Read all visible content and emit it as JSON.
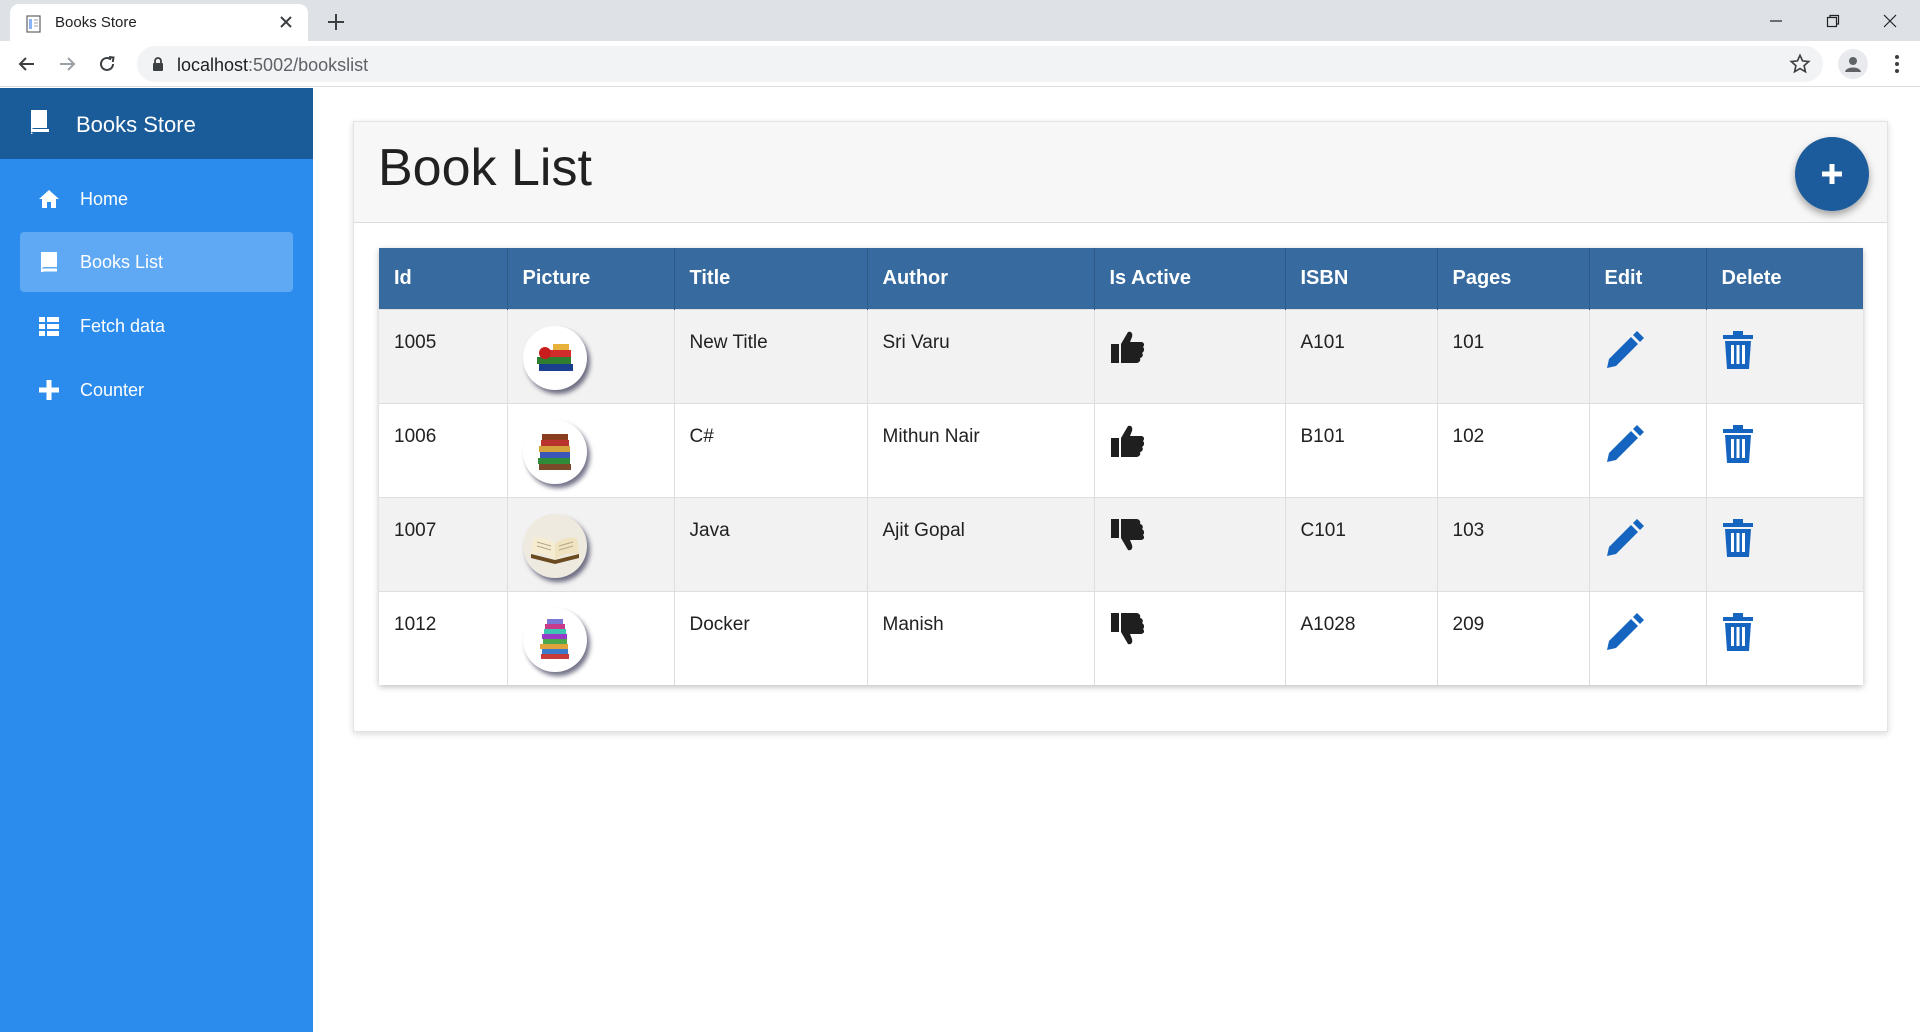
{
  "browser": {
    "tab_title": "Books Store",
    "url_host": "localhost",
    "url_path": ":5002/bookslist"
  },
  "app": {
    "brand": "Books Store"
  },
  "sidebar": {
    "items": [
      {
        "label": "Home",
        "icon": "home-icon",
        "active": false
      },
      {
        "label": "Books List",
        "icon": "book-icon",
        "active": true
      },
      {
        "label": "Fetch data",
        "icon": "list-icon",
        "active": false
      },
      {
        "label": "Counter",
        "icon": "plus-icon",
        "active": false
      }
    ]
  },
  "page": {
    "title": "Book List",
    "add_icon": "plus-icon"
  },
  "table": {
    "headers": [
      "Id",
      "Picture",
      "Title",
      "Author",
      "Is Active",
      "ISBN",
      "Pages",
      "Edit",
      "Delete"
    ],
    "rows": [
      {
        "id": "1005",
        "picture": "book-stack-red",
        "title": "New Title",
        "author": "Sri Varu",
        "is_active": true,
        "isbn": "A101",
        "pages": "101"
      },
      {
        "id": "1006",
        "picture": "book-stack-colored",
        "title": "C#",
        "author": "Mithun Nair",
        "is_active": true,
        "isbn": "B101",
        "pages": "102"
      },
      {
        "id": "1007",
        "picture": "open-book",
        "title": "Java",
        "author": "Ajit Gopal",
        "is_active": false,
        "isbn": "C101",
        "pages": "103"
      },
      {
        "id": "1012",
        "picture": "book-stack-tall",
        "title": "Docker",
        "author": "Manish",
        "is_active": false,
        "isbn": "A1028",
        "pages": "209"
      }
    ]
  },
  "colors": {
    "sidebar": "#2b8ced",
    "brand_bar": "#1a5b99",
    "table_header": "#376a9e",
    "action_blue": "#1565c0",
    "fab": "#1d5c9c"
  }
}
